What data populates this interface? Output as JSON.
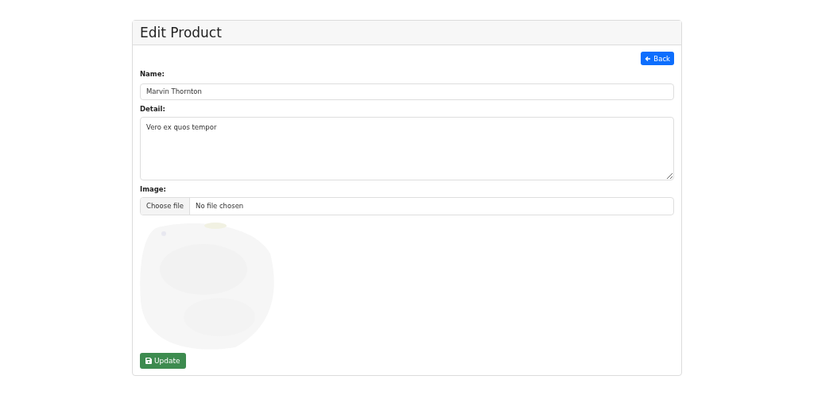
{
  "card": {
    "title": "Edit Product"
  },
  "back_button": {
    "label": "Back"
  },
  "fields": [
    {
      "kind": "text",
      "label": "Name:",
      "value": "Marvin Thornton"
    },
    {
      "kind": "textarea",
      "label": "Detail:",
      "value": "Vero ex quos tempor"
    },
    {
      "kind": "file",
      "label": "Image:",
      "button": "Choose file",
      "value": "No file chosen"
    }
  ],
  "update_button": {
    "label": "Update"
  }
}
